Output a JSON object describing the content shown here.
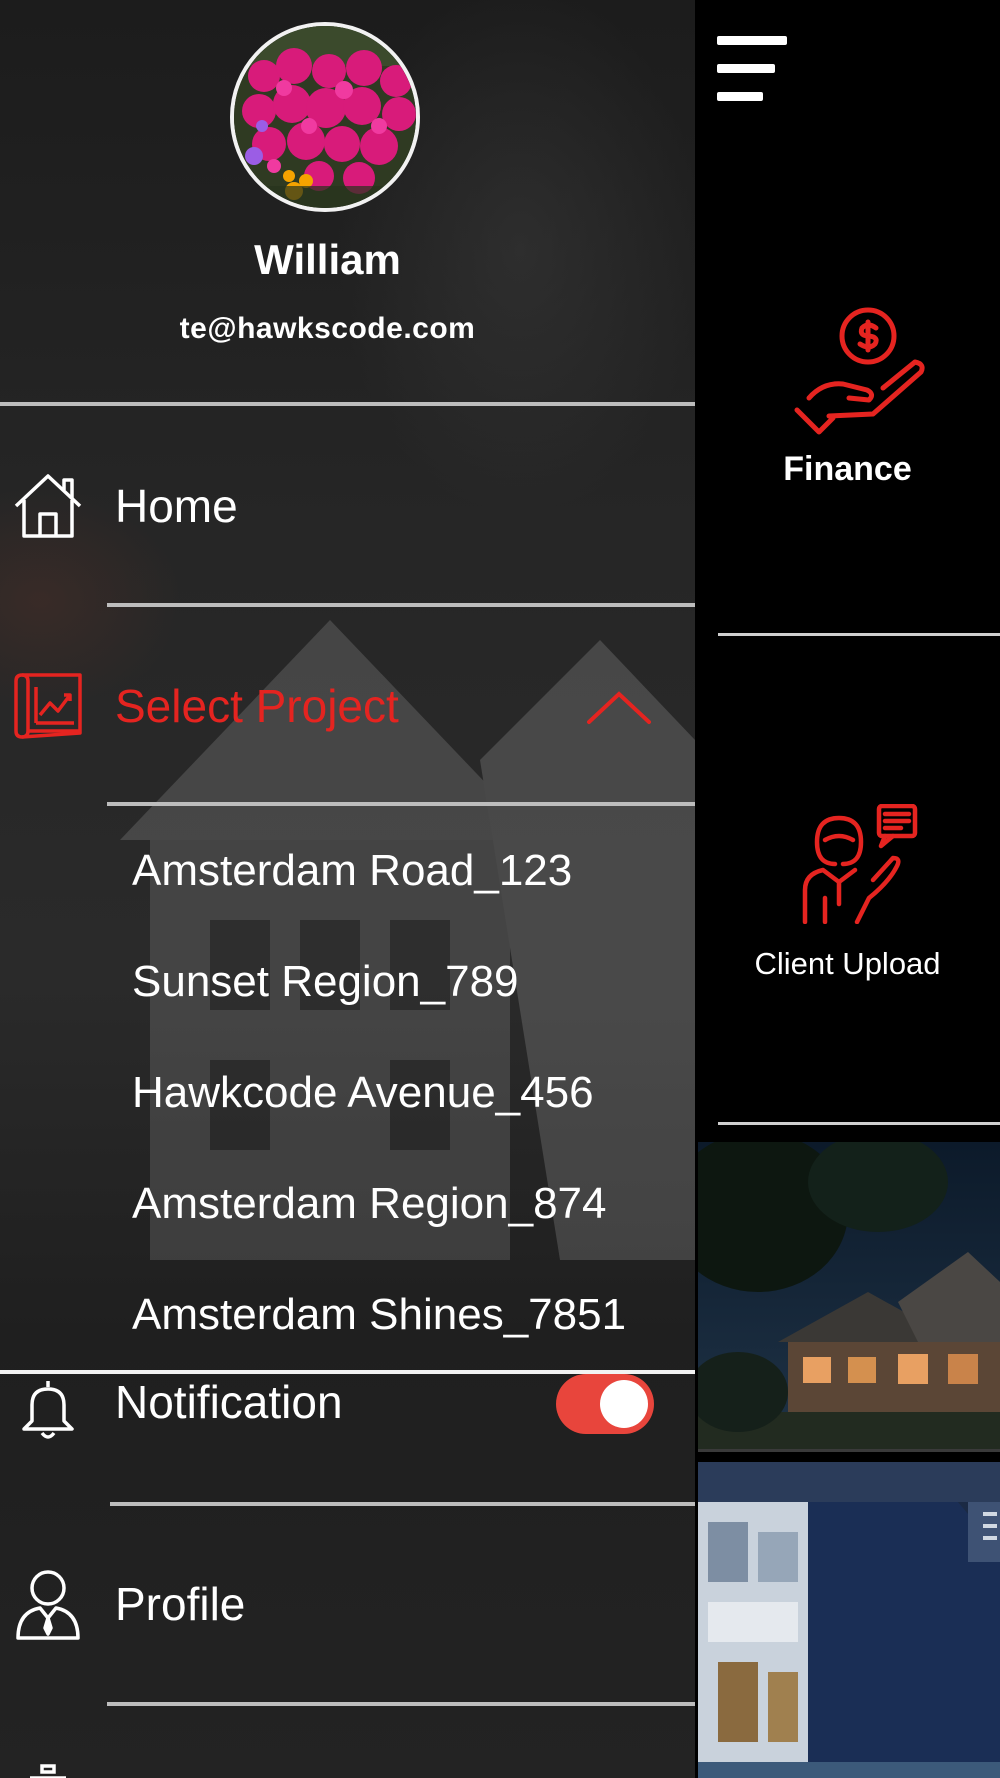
{
  "user": {
    "name": "William",
    "email": "te@hawkscode.com"
  },
  "menu": {
    "home_label": "Home",
    "select_project_label": "Select Project",
    "notification_label": "Notification",
    "notification_enabled": true,
    "profile_label": "Profile"
  },
  "projects": [
    "Amsterdam Road_123",
    "Sunset Region_789",
    "Hawkcode Avenue_456",
    "Amsterdam Region_874",
    "Amsterdam Shines_7851"
  ],
  "main": {
    "tiles": [
      {
        "label": "Finance",
        "icon": "hand-dollar-icon"
      },
      {
        "label": "Client Upload",
        "icon": "client-chat-icon"
      }
    ]
  },
  "colors": {
    "accent": "#e52420",
    "toggle_on": "#e8453c",
    "text": "#ffffff"
  }
}
